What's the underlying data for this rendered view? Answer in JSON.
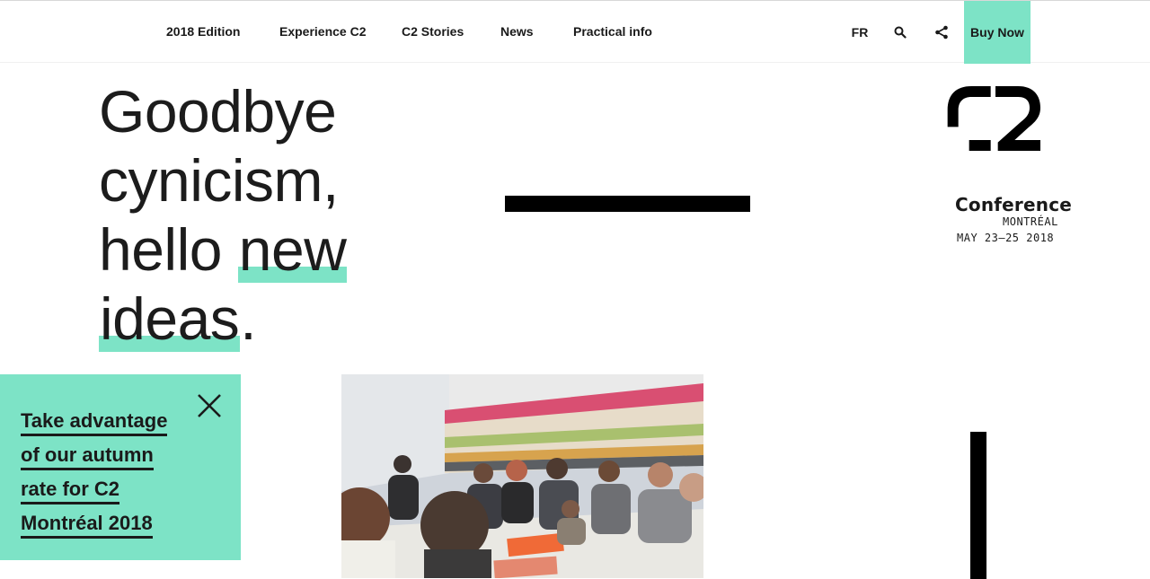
{
  "nav": {
    "items": [
      {
        "label": "2018 Edition"
      },
      {
        "label": "Experience C2"
      },
      {
        "label": "C2 Stories"
      },
      {
        "label": "News"
      },
      {
        "label": "Practical info"
      }
    ],
    "lang": "FR",
    "buy_now": "Buy Now"
  },
  "hero": {
    "line1": "Goodbye",
    "line2": "cynicism,",
    "line3_a": "hello ",
    "line3_b": "new",
    "line4_a": "ideas",
    "line4_b": "."
  },
  "logo": {
    "mark": "C2",
    "conference": "Conference",
    "city": "MONTRÉAL",
    "dates": "MAY 23—25 2018"
  },
  "promo": {
    "lines": [
      "Take advantage",
      "of our autumn",
      "rate for C2",
      "Montréal 2018"
    ]
  },
  "colors": {
    "accent": "#7de3c6",
    "text": "#1a1a1a"
  }
}
